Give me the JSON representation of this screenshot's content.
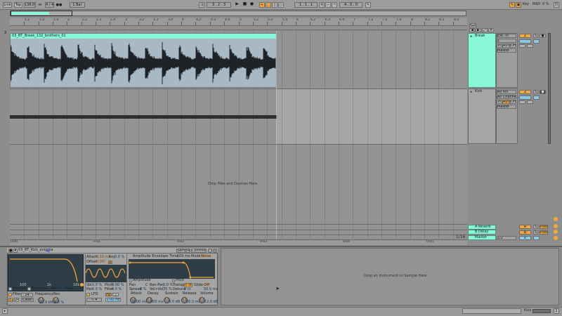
{
  "transport": {
    "link": "Link",
    "tap": "Tap",
    "tempo": "136.00",
    "time_sig": "4 / 4",
    "metronome": "●●",
    "quantize": "1 Bar",
    "position": "3 .   2 .   3",
    "loop_start": "1 .   1 .   1",
    "loop_length": "4 .   0 .   0",
    "key": "Key",
    "midi": "MIDI",
    "cpu": "0 %",
    "d_label": "D"
  },
  "ruler": {
    "bar_labels": [
      "1.2",
      "1.3",
      "1.4",
      "2",
      "2.2",
      "2.3",
      "2.4",
      "3",
      "3.2",
      "3.3",
      "3.4",
      "4",
      "4.2",
      "4.3",
      "4.4",
      "5",
      "5.2",
      "5.3",
      "5.4",
      "6",
      "6.2",
      "6.3",
      "6.4",
      "7",
      "7.2",
      "7.3",
      "7.4",
      "8",
      "8.2",
      "8.3",
      "8.4"
    ],
    "time_labels": [
      "0:00",
      "0:01",
      "0:02",
      "0:03",
      "0:04",
      "0:05",
      "0:06",
      "0:07",
      "0:08",
      "0:09"
    ],
    "set_label": "Set"
  },
  "tracks": [
    {
      "name": "Break",
      "clip_name": "03_BT_Break_132_brothers_01",
      "input_type": "Ext. In",
      "input_channel": "1",
      "monitor": [
        "In",
        "Auto",
        "Off"
      ],
      "output": "Master",
      "number": "1",
      "solo": "S",
      "color": "#87f7d8"
    },
    {
      "name": "Kick",
      "input_type": "All Ins",
      "input_channel": "All Channels",
      "monitor": [
        "In",
        "Auto",
        "Off"
      ],
      "output": "Master",
      "number": "2",
      "solo": "S",
      "color": "#b8b8b8"
    }
  ],
  "drop_label": "Drop Files and Devices Here",
  "returns": [
    {
      "name": "A Reverb",
      "letter": "A",
      "post": "Post",
      "solo": "S"
    },
    {
      "name": "B Delay",
      "letter": "B",
      "post": "Post",
      "solo": "S"
    }
  ],
  "master": {
    "name": "Master",
    "input": "1/2",
    "value": "0"
  },
  "page_indicator": "1/16",
  "device": {
    "title": "03_BT_Kick_enigma",
    "tabs": [
      "Sample",
      "Controls"
    ],
    "filter": {
      "freq_labels": [
        "100",
        "1k",
        "10k"
      ],
      "frequency_label": "Frequency",
      "envelope_label": "Envelope",
      "vel_label": "Vel",
      "vel_value": "0.0 %",
      "key_label": "Key",
      "key_value": "0.0 %",
      "filter_label": "Filter",
      "filter_type": "24",
      "res_label": "Res",
      "clean_label": "Clean",
      "freq_value": "22.0 kHz",
      "res_value": "0.0 %"
    },
    "lfo": {
      "attack_label": "Attack",
      "attack_value": "0.10 ms",
      "key_label": "Key",
      "key_value": "0.0 %",
      "offset_label": "Offset",
      "offset_value": "0.00°",
      "vol_label": "Vol",
      "vol_value": "0.0 %",
      "pitch_label": "Pitch",
      "pitch_value": "0.00 %",
      "pan_label": "Pan",
      "pan_value": "0.0 %",
      "filter_label": "Filter",
      "filter_value": "0.0 %",
      "lfo_label": "LFO",
      "hz_label": "Hz",
      "rate_value": "1.00 Hz"
    },
    "amp": {
      "title": "Amplitude Envelope",
      "time_label": "Time",
      "time_value": "100 ms",
      "mode_label": "Mode",
      "mode_value": "None",
      "amplitude_label": "Amplitude",
      "pitch_label": "Pitch",
      "pan_label": "Pan",
      "pan_value": "C",
      "ranpan_label": "Ran-Pan",
      "ranpan_value": "0.0 %",
      "volvel_label": "Vel>Vol",
      "volvel_value": "35 %",
      "transp_label": "Transp",
      "transp_value": "0 st",
      "detune_label": "Detune",
      "detune_value": "0 ct",
      "glide_label": "Glide",
      "glide_value": "Off",
      "spread_label": "Spread",
      "spread_value": "0 %",
      "time2_value": "50.0 ms"
    },
    "adsr": {
      "attack_label": "Attack",
      "attack_value": "0.00 ms",
      "decay_label": "Decay",
      "decay_value": "600 ms",
      "sustain_label": "Sustain",
      "sustain_value": "0.0 dB",
      "release_label": "Release",
      "release_value": "50.0 ms",
      "volume_label": "Volume",
      "volume_value": "-12.0 dB"
    }
  },
  "instrument_drop_label": "Drop an Instrument or Sample Here",
  "status": {
    "track_label": "Kick",
    "indicator": "1"
  },
  "colors": {
    "accent": "#f2a93b",
    "clip": "#87f7d8",
    "return_a": "#87f7d8",
    "return_b": "#87f7d8",
    "master": "#87f7d8"
  }
}
